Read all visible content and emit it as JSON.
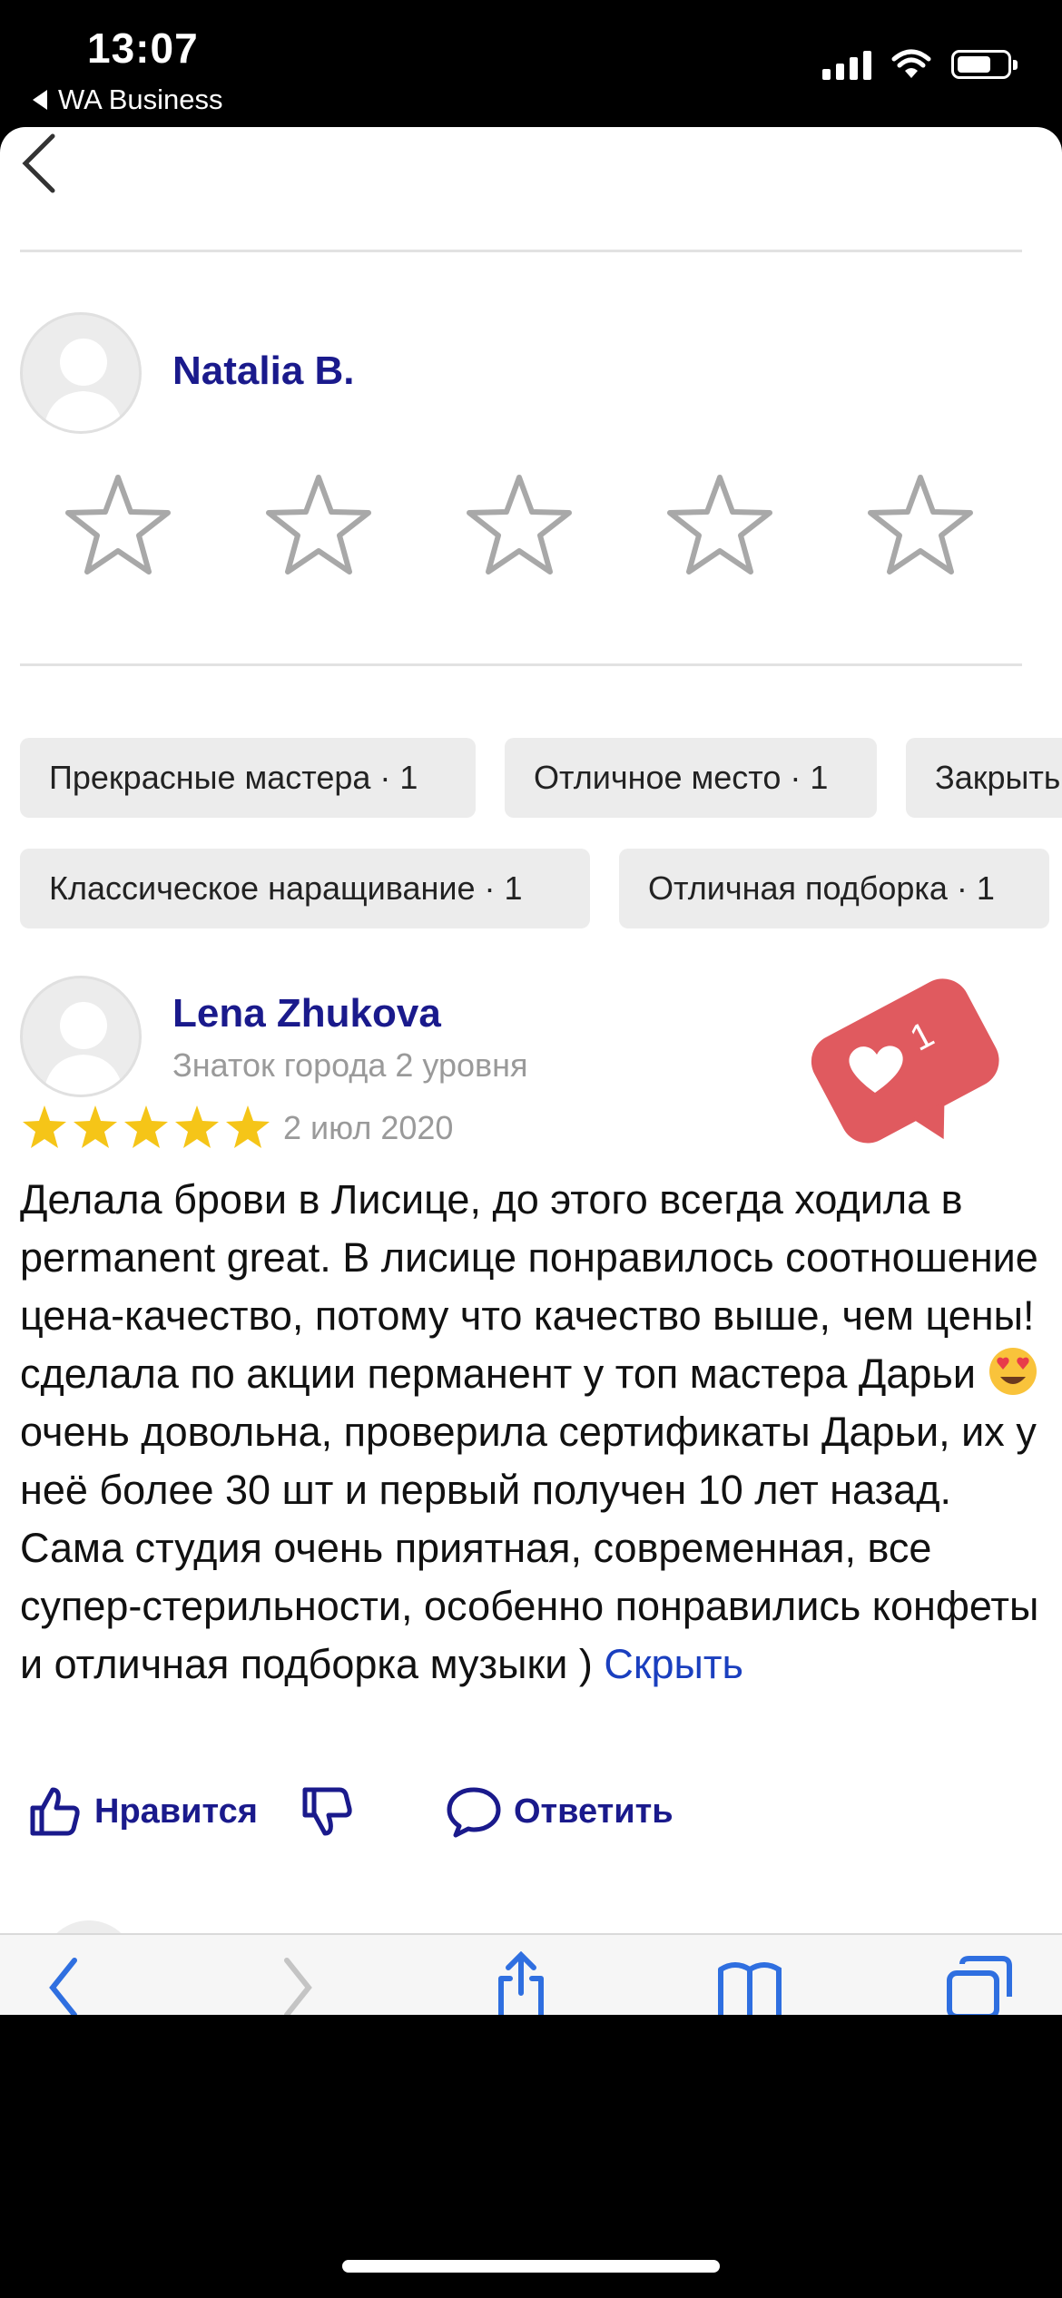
{
  "status_bar": {
    "time": "13:07",
    "back_app": "WA Business"
  },
  "header_reviewer": {
    "name": "Natalia B."
  },
  "rating_input": {
    "stars_total": 5,
    "stars_filled": 0
  },
  "chips": [
    "Прекрасные мастера · 1",
    "Отличное место · 1",
    "Закрыты",
    "Классическое наращивание · 1",
    "Отличная подборка · 1"
  ],
  "review": {
    "author": "Lena Zhukova",
    "level": "Знаток города 2 уровня",
    "rating": 5,
    "date": "2 июл 2020",
    "text_part1": "Делала брови в Лисице, до этого всегда ходила в permanent great. В лисице понравилось соотношение цена-качество, потому что качество выше, чем цены! сделала по акции перманент у топ мастера Дарьи",
    "text_part2": "очень довольна, проверила сертификаты Дарьи, их у неё более 30 шт и первый получен 10 лет назад. Сама студия очень приятная, современная, все супер-стерильности, особенно понравились конфеты и отличная подборка музыки )",
    "hide_link": "Скрыть",
    "emoji_icon": "heart-eyes-emoji"
  },
  "actions": {
    "like_label": "Нравится",
    "reply_label": "Ответить"
  },
  "like_badge": {
    "count": "1",
    "color": "#e05a5f"
  },
  "colors": {
    "accent": "#1a1a8c",
    "link": "#1a3fbf",
    "star_gold": "#f5c518"
  }
}
